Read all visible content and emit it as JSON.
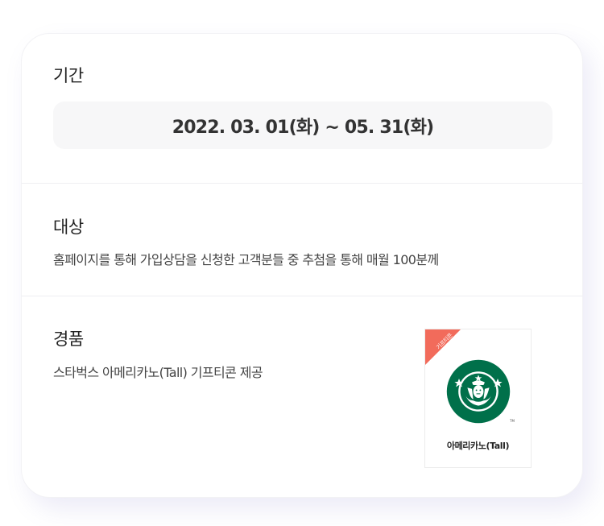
{
  "period": {
    "heading": "기간",
    "value": "2022. 03. 01(화) ~ 05. 31(화)"
  },
  "target": {
    "heading": "대상",
    "description": "홈페이지를 통해 가입상담을 신청한 고객분들 중 추첨을 통해 매월 100분께"
  },
  "prize": {
    "heading": "경품",
    "description": "스타벅스 아메리카노(Tall) 기프티콘 제공",
    "card": {
      "ribbon_label": "기프티콘",
      "product_name": "아메리카노(Tall)",
      "tm_mark": "TM",
      "ribbon_color": "#f26b5b",
      "logo_color": "#00704a"
    }
  }
}
